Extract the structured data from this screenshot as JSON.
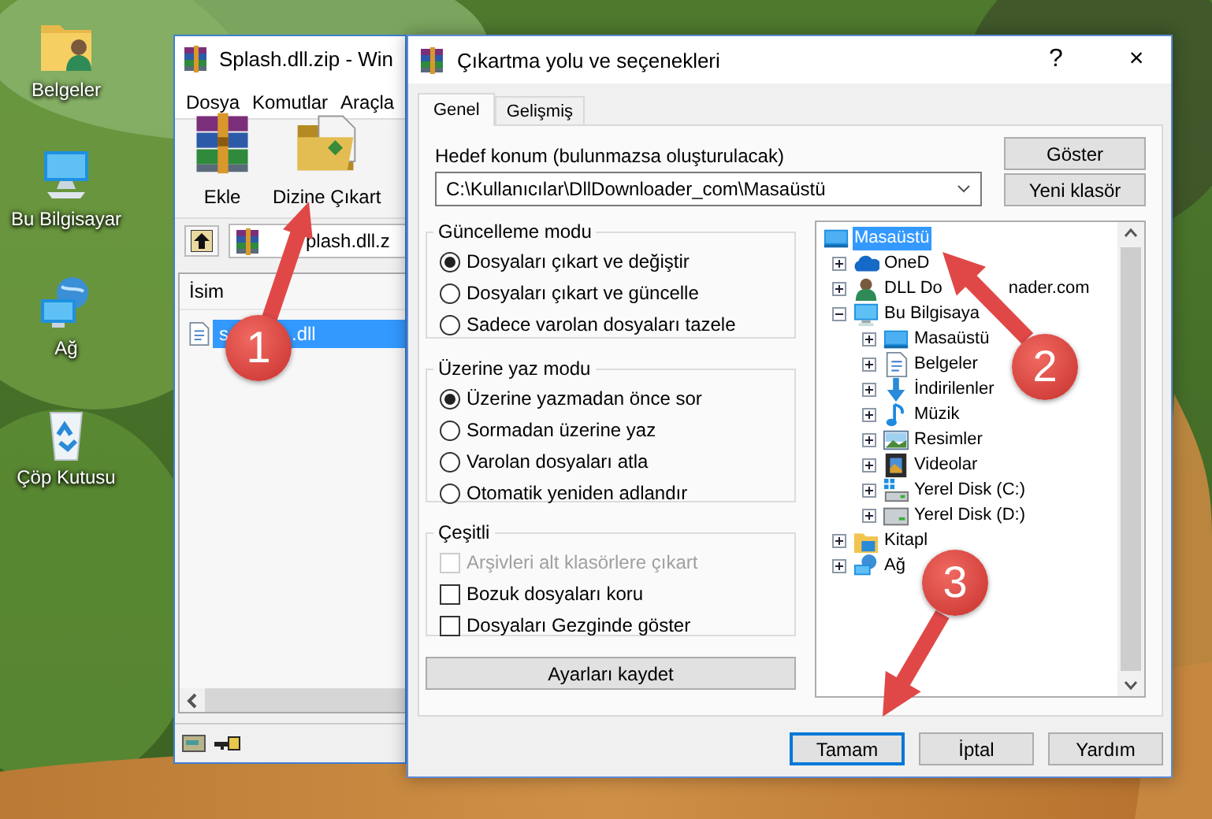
{
  "desktop_icons": [
    {
      "label": "Belgeler",
      "kind": "user-folder"
    },
    {
      "label": "Bu Bilgisayar",
      "kind": "computer"
    },
    {
      "label": "Ağ",
      "kind": "network"
    },
    {
      "label": "Çöp Kutusu",
      "kind": "recycle-bin"
    }
  ],
  "archiver_window": {
    "title": "Splash.dll.zip - Win",
    "menu": [
      "Dosya",
      "Komutlar",
      "Araçla"
    ],
    "toolbar": [
      {
        "label": "Ekle",
        "kind": "add"
      },
      {
        "label": "Dizine Çıkart",
        "kind": "extract"
      }
    ],
    "address": "plash.dll.z",
    "columns": [
      "İsim"
    ],
    "files": [
      {
        "name": "s",
        "name_end": ".dll",
        "selected": true
      }
    ]
  },
  "dialog": {
    "title": "Çıkartma yolu ve seçenekleri",
    "help": "?",
    "close": "×",
    "tabs": [
      {
        "label": "Genel",
        "selected": true
      },
      {
        "label": "Gelişmiş",
        "selected": false
      }
    ],
    "destination_label": "Hedef konum (bulunmazsa oluşturulacak)",
    "destination": "C:\\Kullanıcılar\\DllDownloader_com\\Masaüstü",
    "side_buttons": [
      "Göster",
      "Yeni klasör"
    ],
    "groups": [
      {
        "title": "Güncelleme modu",
        "kind": "radio",
        "options": [
          {
            "label": "Dosyaları çıkart ve değiştir",
            "selected": true
          },
          {
            "label": "Dosyaları çıkart ve güncelle",
            "selected": false
          },
          {
            "label": "Sadece varolan dosyaları tazele",
            "selected": false
          }
        ]
      },
      {
        "title": "Üzerine yaz modu",
        "kind": "radio",
        "options": [
          {
            "label": "Üzerine yazmadan önce sor",
            "selected": true
          },
          {
            "label": "Sormadan üzerine yaz",
            "selected": false
          },
          {
            "label": "Varolan dosyaları atla",
            "selected": false
          },
          {
            "label": "Otomatik yeniden adlandır",
            "selected": false
          }
        ]
      },
      {
        "title": "Çeşitli",
        "kind": "checkbox",
        "options": [
          {
            "label": "Arşivleri alt klasörlere çıkart",
            "checked": false,
            "disabled": true
          },
          {
            "label": "Bozuk dosyaları koru",
            "checked": false,
            "disabled": false
          },
          {
            "label": "Dosyaları Gezginde göster",
            "checked": false,
            "disabled": false
          }
        ]
      }
    ],
    "save_button": "Ayarları kaydet",
    "folder_tree": {
      "label": "Masaüstü",
      "kind": "desktop",
      "selected": true,
      "children": [
        {
          "label": "OneD",
          "kind": "cloud",
          "selected": false,
          "expanded": false
        },
        {
          "label": "DLL Do",
          "label_end": "nader.com",
          "kind": "user",
          "selected": false,
          "expanded": false
        },
        {
          "label": "Bu Bilgisaya",
          "kind": "computer",
          "selected": false,
          "expanded": true,
          "children": [
            {
              "label": "Masaüstü",
              "kind": "desktop",
              "selected": false,
              "expanded": false
            },
            {
              "label": "Belgeler",
              "kind": "document",
              "selected": false,
              "expanded": false
            },
            {
              "label": "İndirilenler",
              "kind": "download",
              "selected": false,
              "expanded": false
            },
            {
              "label": "Müzik",
              "kind": "music",
              "selected": false,
              "expanded": false
            },
            {
              "label": "Resimler",
              "kind": "pictures",
              "selected": false,
              "expanded": false
            },
            {
              "label": "Videolar",
              "kind": "video",
              "selected": false,
              "expanded": false
            },
            {
              "label": "Yerel Disk (C:)",
              "kind": "system-disk",
              "selected": false,
              "expanded": false
            },
            {
              "label": "Yerel Disk (D:)",
              "kind": "disk",
              "selected": false,
              "expanded": false
            }
          ]
        },
        {
          "label": "Kitapl",
          "kind": "library",
          "selected": false,
          "expanded": false
        },
        {
          "label": "Ağ",
          "kind": "network",
          "selected": false,
          "expanded": false
        }
      ]
    },
    "buttons": [
      {
        "label": "Tamam",
        "focused": true
      },
      {
        "label": "İptal",
        "focused": false
      },
      {
        "label": "Yardım",
        "focused": false
      }
    ]
  },
  "annotations": [
    {
      "number": "1"
    },
    {
      "number": "2"
    },
    {
      "number": "3"
    }
  ]
}
